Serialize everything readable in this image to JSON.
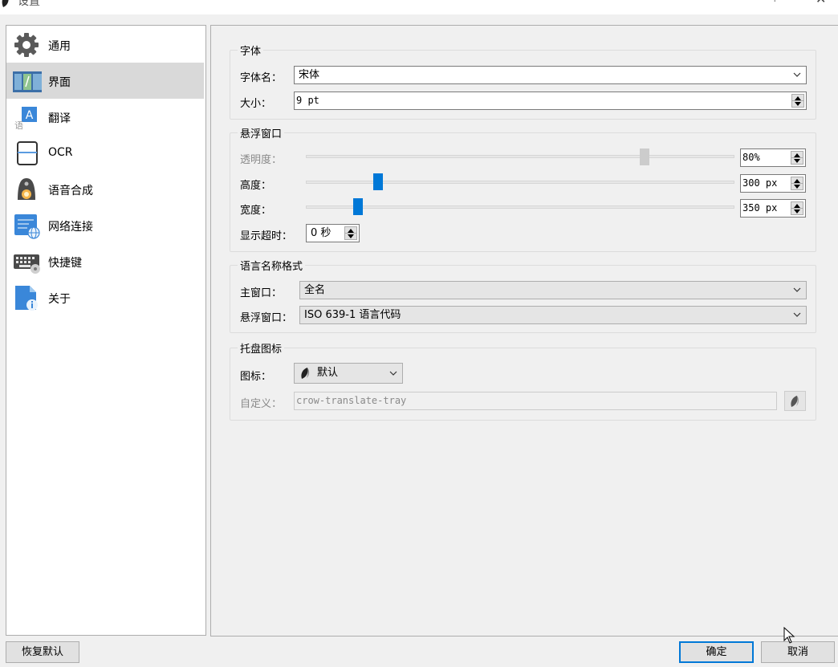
{
  "window": {
    "title": "设置",
    "help_glyph": "?",
    "close_glyph": "✕"
  },
  "sidebar": {
    "items": [
      {
        "label": "通用",
        "icon": "gear-icon"
      },
      {
        "label": "界面",
        "icon": "interface-icon",
        "selected": true
      },
      {
        "label": "翻译",
        "icon": "translate-icon"
      },
      {
        "label": "OCR",
        "icon": "ocr-icon"
      },
      {
        "label": "语音合成",
        "icon": "speech-icon"
      },
      {
        "label": "网络连接",
        "icon": "network-icon"
      },
      {
        "label": "快捷键",
        "icon": "keyboard-icon"
      },
      {
        "label": "关于",
        "icon": "about-icon"
      }
    ]
  },
  "font_group": {
    "title": "字体",
    "name_label": "字体名：",
    "name_value": "宋体",
    "size_label": "大小：",
    "size_value": "9 pt"
  },
  "popup_group": {
    "title": "悬浮窗口",
    "opacity_label": "透明度：",
    "opacity_value": "80%",
    "opacity_level": 0.8,
    "height_label": "高度：",
    "height_value": "300 px",
    "width_label": "宽度：",
    "width_value": "350 px",
    "timeout_label": "显示超时：",
    "timeout_value": "0 秒"
  },
  "lang_group": {
    "title": "语言名称格式",
    "main_label": "主窗口：",
    "main_value": "全名",
    "popup_label": "悬浮窗口：",
    "popup_value": "ISO 639-1 语言代码"
  },
  "tray_group": {
    "title": "托盘图标",
    "icon_label": "图标：",
    "icon_value": "默认",
    "custom_label": "自定义：",
    "custom_value": "crow-translate-tray"
  },
  "footer": {
    "restore_label": "恢复默认",
    "ok_label": "确定",
    "cancel_label": "取消"
  },
  "colors": {
    "accent": "#0078d7",
    "selection": "#d9d9d9"
  }
}
